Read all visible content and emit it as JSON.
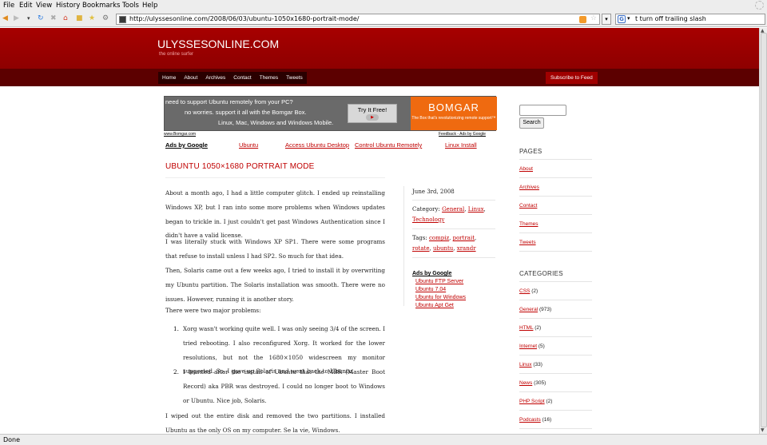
{
  "browser": {
    "menu": [
      "File",
      "Edit",
      "View",
      "History",
      "Bookmarks",
      "Tools",
      "Help"
    ],
    "url": "http://ulyssesonline.com/2008/06/03/ubuntu-1050x1680-portrait-mode/",
    "search_engine_icon": "G",
    "search_text": "t turn off trailing slash",
    "status": "Done"
  },
  "site": {
    "title": "ULYSSESONLINE.COM",
    "tagline": "the online surfer",
    "nav": [
      "Home",
      "About",
      "Archives",
      "Contact",
      "Themes",
      "Tweets"
    ],
    "subscribe": "Subscribe to Feed"
  },
  "banner_ad": {
    "line1": "need to support Ubuntu remotely from your PC?",
    "line2": "no worries. support it all with the Bomgar Box.",
    "line3": "Linux, Mac, Windows and Windows Mobile.",
    "button": "Try It Free!",
    "brand": "BOMGAR",
    "brand_sub": "The Box that's revolutionizing remote support™",
    "left_link": "www.Bomgar.com",
    "right_link": "Feedback - Ads by Google"
  },
  "ads_row": {
    "label": "Ads by Google",
    "links": [
      "Ubuntu",
      "Access Ubuntu Desktop",
      "Control Ubuntu Remotely",
      "Linux Install"
    ]
  },
  "post": {
    "title": "UBUNTU 1050×1680 PORTRAIT MODE",
    "p1": "About a month ago, I had a little computer glitch. I ended up reinstalling Windows XP, but I ran into some more problems when Windows updates began to trickle in. I just couldn't get past Windows Authentication since I didn't have a valid license.",
    "p2": "I was literally stuck with Windows XP SP1. There were some programs that refuse to install unless I had SP2. So much for that idea.",
    "p3": "Then, Solaris came out a few weeks ago, I tried to install it by overwriting my Ubuntu partition. The Solaris installation was smooth. There were no issues. However, running it is another story.",
    "p4": "There were two major problems:",
    "item1_num": "1.",
    "item1": "Xorg wasn't working quite well. I was only seeing 3/4 of the screen. I tried rebooting. I also reconfigured Xorg. It worked for the lower resolutions, but not the 1680×1050 widescreen my monitor supported. So, I gave up Solaris and went back to Ubuntu.",
    "item2_num": "2.",
    "item2": "I learned after the install of Ubuntu that the MBR (Master Boot Record) aka PBR was destroyed. I could no longer boot to Windows or Ubuntu. Nice job, Solaris.",
    "p5": "I wiped out the entire disk and removed the two partitions. I installed Ubuntu as the only OS on my computer. Se la vie, Windows."
  },
  "meta": {
    "date": "June 3rd, 2008",
    "category_label": "Category:",
    "categories": [
      "General",
      "Linux",
      "Technology"
    ],
    "tags_label": "Tags:",
    "tags": [
      "compiz",
      "portrait",
      "rotate",
      "ubuntu",
      "xrandr"
    ],
    "ads_label": "Ads by Google",
    "ads": [
      "Ubuntu FTP Server",
      "Ubuntu 7.04",
      "Ubuntu for Windows",
      "Ubuntu Apt Get"
    ]
  },
  "sidebar": {
    "search_button": "Search",
    "pages_heading": "PAGES",
    "pages": [
      "About",
      "Archives",
      "Contact",
      "Themes",
      "Tweets"
    ],
    "categories_heading": "CATEGORIES",
    "categories": [
      {
        "name": "CSS",
        "count": "(2)"
      },
      {
        "name": "General",
        "count": "(973)"
      },
      {
        "name": "HTML",
        "count": "(2)"
      },
      {
        "name": "Internet",
        "count": "(5)"
      },
      {
        "name": "Linux",
        "count": "(33)"
      },
      {
        "name": "News",
        "count": "(305)"
      },
      {
        "name": "PHP Script",
        "count": "(2)"
      },
      {
        "name": "Podcasts",
        "count": "(16)"
      }
    ]
  },
  "colors": {
    "brand_red": "#a70000",
    "nav_dark": "#5c0000",
    "link": "#c00000",
    "ad_orange": "#ef6a10"
  }
}
